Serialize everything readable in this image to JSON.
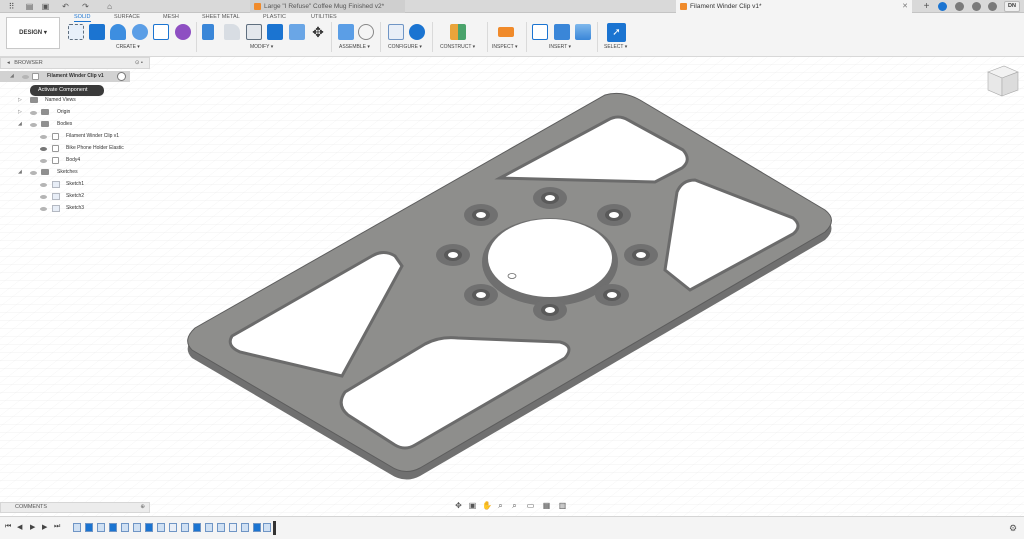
{
  "titlebar": {
    "tabs": [
      {
        "label": "Large \"I Refuse\" Coffee Mug Finished v2*",
        "active": false
      },
      {
        "label": "Filament Winder Clip v1*",
        "active": true
      }
    ],
    "user_initials": "DN",
    "icons": [
      "grid-icon",
      "file-icon",
      "save-icon",
      "undo-icon",
      "redo-icon",
      "home-icon",
      "new-tab-icon",
      "extensions-icon",
      "job-status-icon",
      "notifications-icon",
      "help-icon"
    ]
  },
  "toolbar": {
    "workspace_label": "DESIGN",
    "tabs": [
      "SOLID",
      "SURFACE",
      "MESH",
      "SHEET METAL",
      "PLASTIC",
      "UTILITIES"
    ],
    "active_tab": "SOLID",
    "groups": [
      "CREATE",
      "MODIFY",
      "ASSEMBLE",
      "CONFIGURE",
      "CONSTRUCT",
      "INSPECT",
      "INSERT",
      "SELECT"
    ]
  },
  "browser": {
    "header": "BROWSER",
    "tooltip": "Activate Component",
    "root": "Filament Winder Clip v1",
    "items": [
      {
        "label": "Named Views",
        "type": "folder"
      },
      {
        "label": "Origin",
        "type": "folder"
      },
      {
        "label": "Bodies",
        "type": "folder"
      },
      {
        "label": "Filament Winder Clip v1",
        "type": "body"
      },
      {
        "label": "Bike Phone Holder Elastic",
        "type": "body"
      },
      {
        "label": "Body4",
        "type": "body"
      },
      {
        "label": "Sketches",
        "type": "folder"
      },
      {
        "label": "Sketch1",
        "type": "sketch"
      },
      {
        "label": "Sketch2",
        "type": "sketch"
      },
      {
        "label": "Sketch3",
        "type": "sketch"
      }
    ]
  },
  "comments": {
    "label": "COMMENTS"
  },
  "navbar": {
    "icons": [
      "orbit-icon",
      "look-at-icon",
      "pan-icon",
      "zoom-icon",
      "zoom-window-icon",
      "display-settings-icon",
      "grid-settings-icon",
      "viewports-icon"
    ]
  },
  "timeline": {
    "controls": [
      "first-icon",
      "previous-icon",
      "play-icon",
      "next-icon",
      "last-icon"
    ]
  },
  "colors": {
    "accent": "#1b74d1",
    "model": "#8c8c8c"
  }
}
